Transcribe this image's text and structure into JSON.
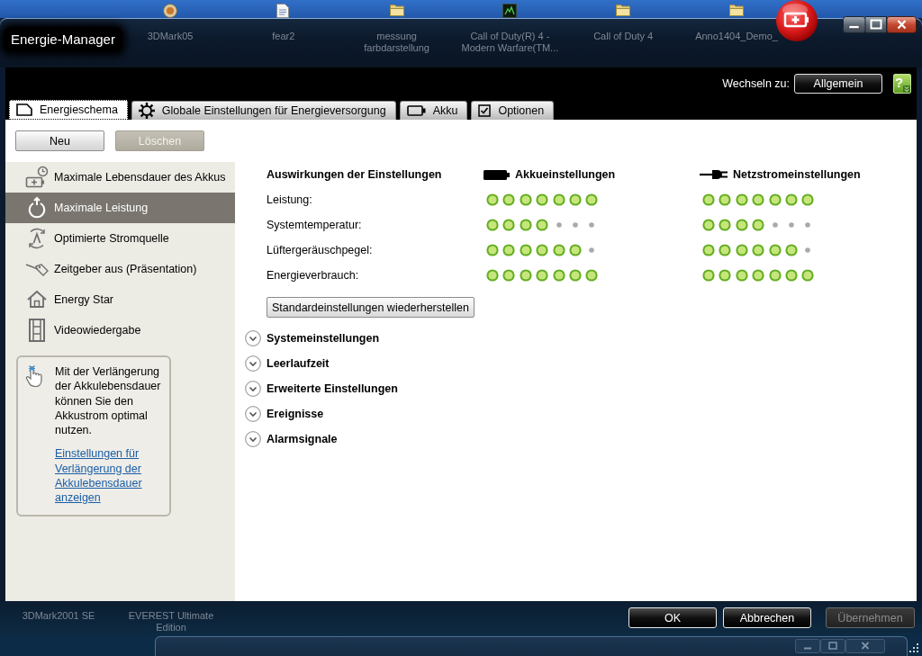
{
  "desktop": {
    "top_icons": [
      {
        "label": "3DMark05",
        "kind": "disc"
      },
      {
        "label": "fear2",
        "kind": "document"
      },
      {
        "label": "messung farbdarstellung",
        "kind": "folder"
      },
      {
        "label": "Call of Duty(R) 4 - Modern Warfare(TM...",
        "kind": "tile"
      },
      {
        "label": "Call of Duty 4",
        "kind": "folder"
      },
      {
        "label": "Anno1404_Demo_",
        "kind": "folder"
      }
    ],
    "bottom_icons": [
      {
        "label": "3DMark2001 SE"
      },
      {
        "label": "EVEREST Ultimate Edition"
      }
    ]
  },
  "window": {
    "title": "Energie-Manager"
  },
  "switch_bar": {
    "label": "Wechseln zu:",
    "button": "Allgemein",
    "help_button": "?"
  },
  "tabs": [
    {
      "label": "Energieschema",
      "kind": "document",
      "selected": true
    },
    {
      "label": "Globale Einstellungen für Energieversorgung",
      "kind": "gear",
      "selected": false
    },
    {
      "label": "Akku",
      "kind": "battery",
      "selected": false
    },
    {
      "label": "Optionen",
      "kind": "checkbox",
      "selected": false
    }
  ],
  "toolbar": {
    "buttons": [
      {
        "label": "Neu",
        "disabled": false
      },
      {
        "label": "Löschen",
        "disabled": true
      }
    ]
  },
  "sidebar": {
    "items": [
      {
        "label": "Maximale Lebensdauer des Akkus",
        "kind": "battery-clock",
        "selected": false
      },
      {
        "label": "Maximale Leistung",
        "kind": "power",
        "selected": true
      },
      {
        "label": "Optimierte Stromquelle",
        "kind": "cycle",
        "selected": false
      },
      {
        "label": "Zeitgeber aus (Präsentation)",
        "kind": "tag",
        "selected": false
      },
      {
        "label": "Energy Star",
        "kind": "home",
        "selected": false
      },
      {
        "label": "Videowiedergabe",
        "kind": "film",
        "selected": false
      }
    ],
    "tip": {
      "text": "Mit der Verlängerung der Akkulebensdauer können Sie den Akkustrom optimal nutzen.",
      "link": "Einstellungen für Verlängerung der Akkulebensdauer anzeigen"
    }
  },
  "effects": {
    "title": "Auswirkungen der Einstellungen",
    "columns": [
      {
        "label": "Akkueinstellungen",
        "kind": "battery"
      },
      {
        "label": "Netzstromeinstellungen",
        "kind": "plug"
      }
    ],
    "rows": [
      {
        "label": "Leistung:",
        "meters": [
          {
            "stars": 7
          },
          {
            "stars": 7
          }
        ]
      },
      {
        "label": "Systemtemperatur:",
        "meters": [
          {
            "stars": 4
          },
          {
            "stars": 4
          }
        ]
      },
      {
        "label": "Lüftergeräuschpegel:",
        "meters": [
          {
            "stars": 6
          },
          {
            "stars": 6
          }
        ]
      },
      {
        "label": "Energieverbrauch:",
        "meters": [
          {
            "stars": 7
          },
          {
            "stars": 7
          }
        ]
      }
    ],
    "reset_button": "Standardeinstellungen wiederherstellen"
  },
  "sections": [
    {
      "label": "Systemeinstellungen",
      "expanded": false
    },
    {
      "label": "Leerlaufzeit",
      "expanded": false
    },
    {
      "label": "Erweiterte Einstellungen",
      "expanded": false
    },
    {
      "label": "Ereignisse",
      "expanded": false
    },
    {
      "label": "Alarmsignale",
      "expanded": false
    }
  ],
  "footer": {
    "buttons": [
      {
        "label": "OK",
        "disabled": false
      },
      {
        "label": "Abbrechen",
        "disabled": false
      },
      {
        "label": "Übernehmen",
        "disabled": true
      }
    ]
  }
}
